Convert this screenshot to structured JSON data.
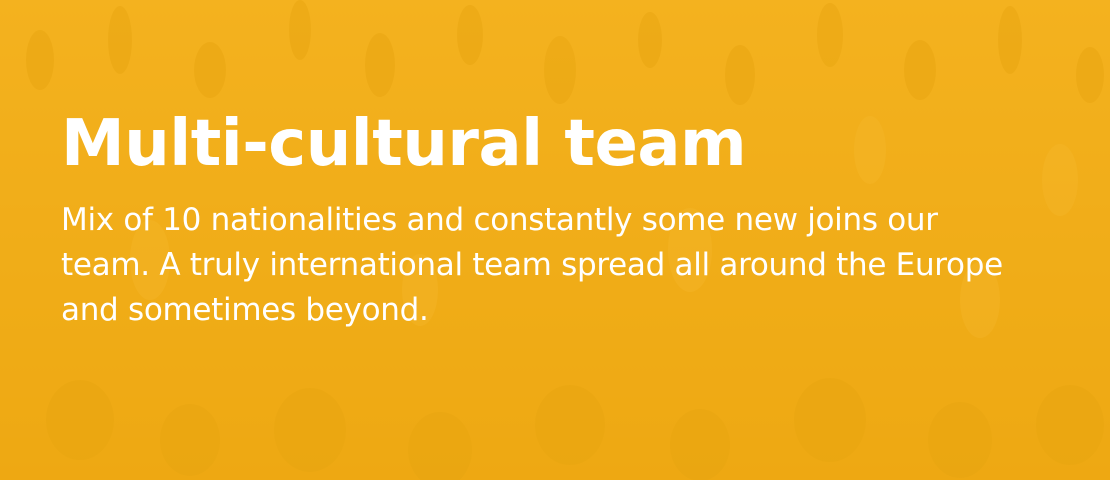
{
  "hero": {
    "background_color": "#F2AE16",
    "text_color": "#FFFFFF",
    "title": "Multi-cultural team",
    "body": "Mix of 10 nationalities and constantly some new joins our team. A truly international team spread all around the Europe and sometimes beyond."
  }
}
